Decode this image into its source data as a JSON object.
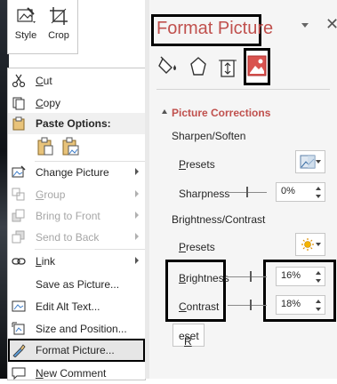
{
  "mini_toolbar": {
    "style_label": "Style",
    "crop_label": "Crop"
  },
  "context_menu": {
    "cut": {
      "label": "Cut",
      "icon": "scissors-icon"
    },
    "copy": {
      "label": "Copy",
      "icon": "copy-icon"
    },
    "paste_options": {
      "label": "Paste Options:",
      "icon": "clipboard-icon"
    },
    "change_picture": {
      "label": "Change Picture",
      "icon": "change-picture-icon"
    },
    "group": {
      "label": "Group",
      "icon": "group-icon",
      "disabled": true
    },
    "bring_to_front": {
      "label": "Bring to Front",
      "icon": "bring-to-front-icon",
      "disabled": true
    },
    "send_to_back": {
      "label": "Send to Back",
      "icon": "send-to-back-icon",
      "disabled": true
    },
    "link": {
      "label": "Link",
      "icon": "link-icon"
    },
    "save_as_picture": {
      "label": "Save as Picture..."
    },
    "edit_alt_text": {
      "label": "Edit Alt Text...",
      "icon": "alt-text-icon"
    },
    "size_and_position": {
      "label": "Size and Position...",
      "icon": "size-position-icon"
    },
    "format_picture": {
      "label": "Format Picture...",
      "icon": "format-picture-icon",
      "highlighted": true
    },
    "new_comment": {
      "label": "New Comment",
      "icon": "comment-icon"
    }
  },
  "format_pane": {
    "title": "Format Picture",
    "tabs": [
      "fill-line-icon",
      "effects-icon",
      "size-properties-icon",
      "picture-icon"
    ],
    "selected_tab": "picture-icon",
    "section_title": "Picture Corrections",
    "sharpen": {
      "heading": "Sharpen/Soften",
      "presets_label": "Presets",
      "sharpness_label": "Sharpness",
      "sharpness_value": "0%",
      "sharpness_level": 0.5
    },
    "brightness_contrast": {
      "heading": "Brightness/Contrast",
      "presets_label": "Presets",
      "brightness_label": "Brightness",
      "brightness_value": "16%",
      "brightness_level": 0.58,
      "contrast_label": "Contrast",
      "contrast_value": "18%",
      "contrast_level": 0.59
    },
    "reset_label": "Reset"
  },
  "colors": {
    "accent": "#c0504d",
    "highlight_border": "#000000"
  }
}
